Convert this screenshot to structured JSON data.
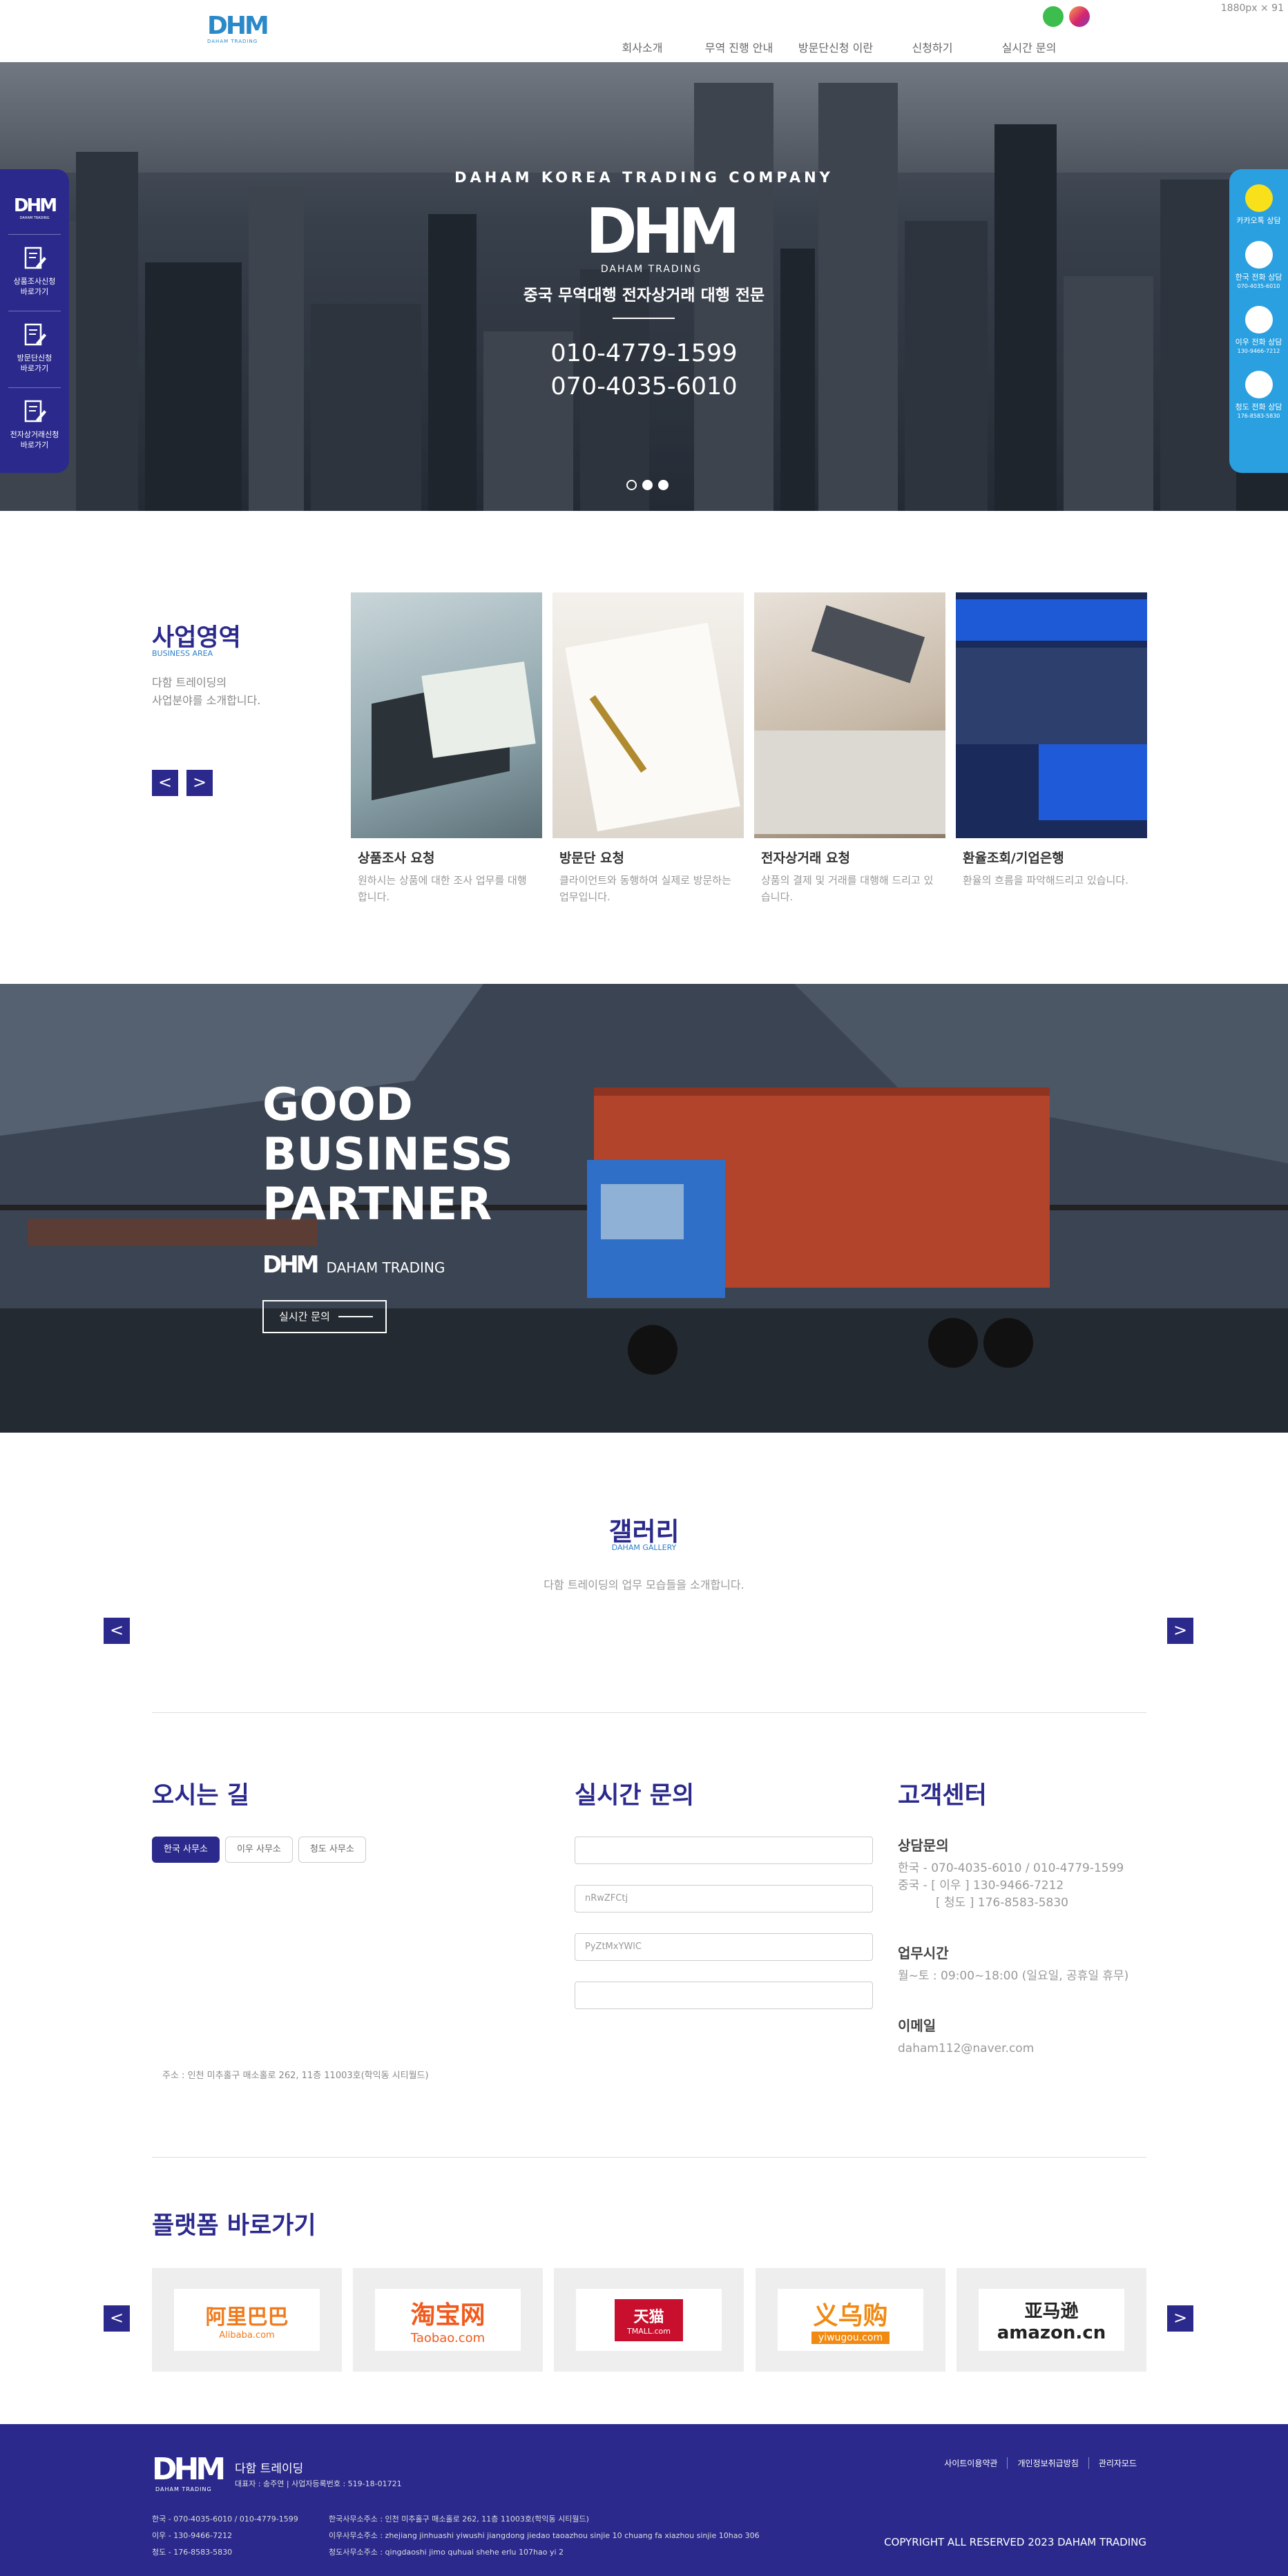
{
  "viewport_label": "1880px × 91",
  "brand": {
    "logo": "DHM",
    "logo_sub": "DAHAM TRADING"
  },
  "nav": {
    "items": [
      "회사소개",
      "무역 진행 안내",
      "방문단신청 이란",
      "신청하기",
      "실시간 문의"
    ]
  },
  "social": [
    "kakaotalk-icon",
    "instagram-icon"
  ],
  "hero": {
    "tagline": "DAHAM KOREA TRADING COMPANY",
    "title": "중국 무역대행 전자상거래 대행 전문",
    "phone1": "010-4779-1599",
    "phone2": "070-4035-6010"
  },
  "quick_left": {
    "logo": "DHM",
    "logo_sub": "DAHAM TRADING",
    "items": [
      {
        "line1": "상품조사신청",
        "line2": "바로가기"
      },
      {
        "line1": "방문단신청",
        "line2": "바로가기"
      },
      {
        "line1": "전자상거래신청",
        "line2": "바로가기"
      }
    ]
  },
  "quick_right": {
    "items": [
      {
        "label": "카카오톡 상담",
        "num": ""
      },
      {
        "label": "한국 전화 상담",
        "num": "070-4035-6010"
      },
      {
        "label": "이우 전화 상담",
        "num": "130-9466-7212"
      },
      {
        "label": "청도 전화 상담",
        "num": "176-8583-5830"
      }
    ]
  },
  "business": {
    "title": "사업영역",
    "subtitle": "BUSINESS AREA",
    "desc_line1": "다함 트레이딩의",
    "desc_line2": "사업분야를 소개합니다.",
    "prev": "<",
    "next": ">",
    "cards": [
      {
        "name": "상품조사 요청",
        "text": "원하시는 상품에 대한 조사 업무를 대행합니다."
      },
      {
        "name": "방문단 요청",
        "text": "클라이언트와 동행하여 실제로 방문하는 업무입니다."
      },
      {
        "name": "전자상거래 요청",
        "text": "상품의 결제 및 거래를 대행해 드리고 있습니다."
      },
      {
        "name": "환율조회/기업은행",
        "text": "환율의 흐름을 파악해드리고 있습니다."
      }
    ]
  },
  "banner": {
    "line1": "GOOD",
    "line2": "BUSINESS",
    "line3": "PARTNER",
    "logo": "DHM",
    "logo_text": "DAHAM TRADING",
    "button": "실시간 문의"
  },
  "gallery": {
    "title": "갤러리",
    "subtitle": "DAHAM GALLERY",
    "desc": "다함 트레이딩의 업무 모습들을 소개합니다.",
    "prev": "<",
    "next": ">"
  },
  "directions": {
    "title": "오시는 길",
    "tabs": [
      "한국 사무소",
      "이우 사무소",
      "청도 사무소"
    ],
    "active_tab": 0,
    "address": "주소 : 인천 미추홀구 매소홀로 262, 11층 11003호(학익동 시티월드)"
  },
  "inquiry": {
    "title": "실시간 문의",
    "fields": [
      "",
      "nRwZFCtj",
      "PyZtMxYWlC",
      ""
    ]
  },
  "cs": {
    "title": "고객센터",
    "consult_heading": "상담문의",
    "consult_lines": [
      "한국 - 070-4035-6010 / 010-4779-1599",
      "중국 - [ 이우 ] 130-9466-7212",
      "[ 청도 ] 176-8583-5830"
    ],
    "hours_heading": "업무시간",
    "hours": "월~토 : 09:00~18:00 (일요일, 공휴일 휴무)",
    "email_heading": "이메일",
    "email": "daham112@naver.com"
  },
  "platforms": {
    "title": "플랫폼 바로가기",
    "prev": "<",
    "next": ">",
    "items": [
      {
        "name": "Alibaba.com",
        "label": "阿里巴巴",
        "sub": "Alibaba.com",
        "color": "#f07a1b"
      },
      {
        "name": "Taobao.com",
        "label": "淘宝网",
        "sub": "Taobao.com",
        "color": "#f05a1d"
      },
      {
        "name": "TMALL.com",
        "label": "天猫",
        "sub": "TMALL.com",
        "color": "#c8102e"
      },
      {
        "name": "yiwugou.com",
        "label": "义乌购",
        "sub": "yiwugou.com",
        "color": "#f08a12"
      },
      {
        "name": "amazon.cn",
        "label": "亚马逊",
        "sub": "amazon.cn",
        "color": "#222222"
      }
    ]
  },
  "footer": {
    "logo": "DHM",
    "logo_sub": "DAHAM TRADING",
    "company": "다함 트레이딩",
    "info": "대표자 : 송주연   |   사업자등록번호 : 519-18-01721",
    "phones": [
      "한국 - 070-4035-6010 / 010-4779-1599",
      "이우 - 130-9466-7212",
      "청도 - 176-8583-5830"
    ],
    "offices": [
      "한국사무소주소 : 인천 미추홀구 매소홀로 262, 11층 11003호(학익동 시티월드)",
      "이우사무소주소 : zhejiang jinhuashi yiwushi jiangdong jiedao taoazhou sinjie 10 chuang fa xiazhou sinjie 10hao 306",
      "청도사무소주소 : qingdaoshi jimo quhuai shehe erlu 107hao yi 2"
    ],
    "links": [
      "사이트이용약관",
      "개인정보취급방침",
      "관리자모드"
    ],
    "copyright": "COPYRIGHT ALL RESERVED 2023 DAHAM TRADING"
  },
  "colors": {
    "primary": "#2b2a8c",
    "accent_blue": "#2aa0e0",
    "logo_blue": "#2a89c9"
  }
}
